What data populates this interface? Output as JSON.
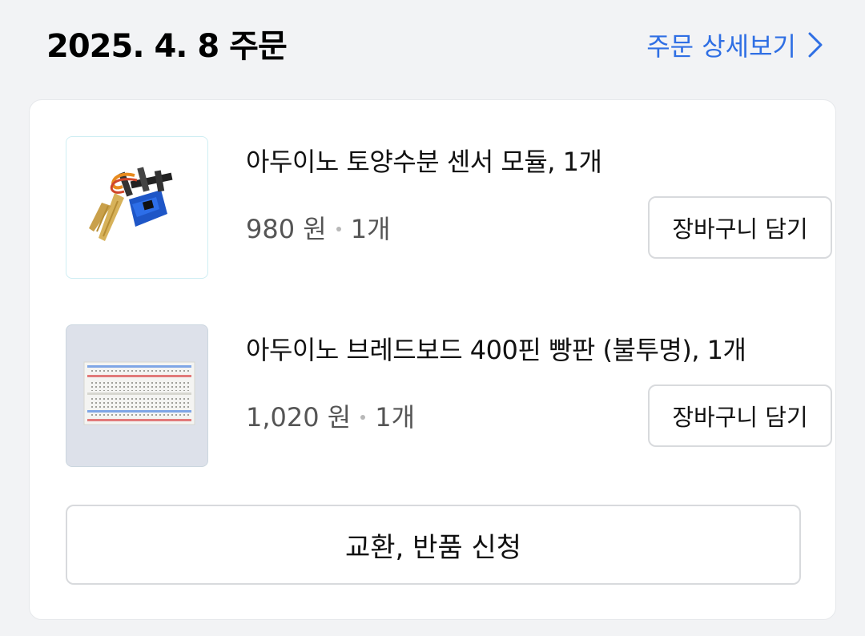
{
  "header": {
    "order_date_title": "2025. 4. 8 주문",
    "detail_link_label": "주문 상세보기"
  },
  "items": [
    {
      "name": "아두이노 토양수분 센서 모듈, 1개",
      "price": "980 원",
      "quantity": "1개",
      "cart_button_label": "장바구니 담기"
    },
    {
      "name": "아두이노 브레드보드 400핀 빵판 (불투명), 1개",
      "price": "1,020 원",
      "quantity": "1개",
      "cart_button_label": "장바구니 담기"
    }
  ],
  "return_button_label": "교환, 반품 신청",
  "colors": {
    "link": "#2f6fe4",
    "background": "#f2f3f5",
    "card": "#ffffff"
  },
  "icons": {
    "detail_link": "chevron-right-icon"
  }
}
